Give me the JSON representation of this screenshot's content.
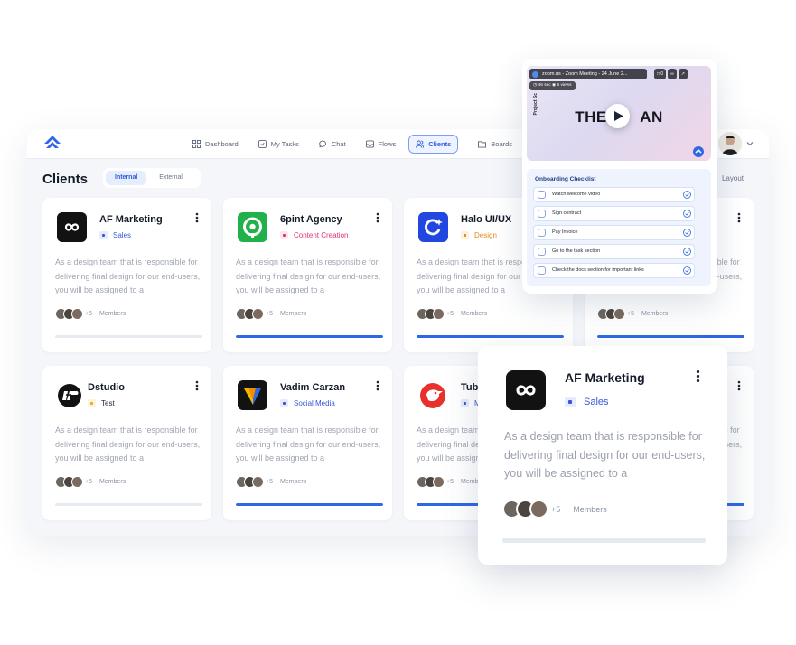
{
  "nav": {
    "items": [
      {
        "label": "Dashboard",
        "icon": "grid-icon"
      },
      {
        "label": "My Tasks",
        "icon": "checkbox-icon"
      },
      {
        "label": "Chat",
        "icon": "chat-bubble-icon"
      },
      {
        "label": "Flows",
        "icon": "inbox-icon"
      },
      {
        "label": "Clients",
        "icon": "users-icon",
        "active": true
      },
      {
        "label": "Boards",
        "icon": "folder-icon"
      }
    ]
  },
  "page": {
    "title": "Clients",
    "segments": [
      "Internal",
      "External"
    ],
    "active_segment": "Internal",
    "layout_label": "Layout"
  },
  "colors": {
    "accent": "#2e68e6",
    "sales": "#3558d6",
    "content_creation": "#e0347a",
    "design": "#e08a1a",
    "test": "#e0a82e",
    "social_media": "#3558d6"
  },
  "desc": "As a design team that is responsible for delivering final design for our end-users, you will be assigned to a",
  "members": {
    "more": "+5",
    "label": "Members"
  },
  "cards": [
    {
      "name": "AF Marketing",
      "tag": "Sales",
      "progress": 0
    },
    {
      "name": "6pint Agency",
      "tag": "Content Creation",
      "progress": 100
    },
    {
      "name": "Halo UI/UX",
      "tag": "Design",
      "progress": 100
    },
    {
      "name": "",
      "tag": "",
      "progress": 100
    },
    {
      "name": "Dstudio",
      "tag": "Test",
      "progress": 0
    },
    {
      "name": "Vadim Carzan",
      "tag": "Social Media",
      "progress": 100
    },
    {
      "name": "Tubi",
      "tag": "M",
      "progress": 100
    },
    {
      "name": "",
      "tag": "",
      "progress": 100
    }
  ],
  "popup": {
    "name": "AF Marketing",
    "tag": "Sales",
    "desc": "As a design team that is responsible for delivering final design for our end-users, you will be assigned to a",
    "more": "+5",
    "members_label": "Members",
    "progress": 0
  },
  "video": {
    "title": "zoom.us - Zoom Meeting - 24 June 2...",
    "comments": "0",
    "duration": "46 sec",
    "views": "5 views",
    "side_label": "Project Sc",
    "headline_left": "THE",
    "headline_right": "AN"
  },
  "checklist": {
    "title": "Onboarding Checklist",
    "items": [
      "Watch welcome video",
      "Sign contract",
      "Pay Invoice",
      "Go to the task section",
      "Check the docs section for important links"
    ]
  }
}
